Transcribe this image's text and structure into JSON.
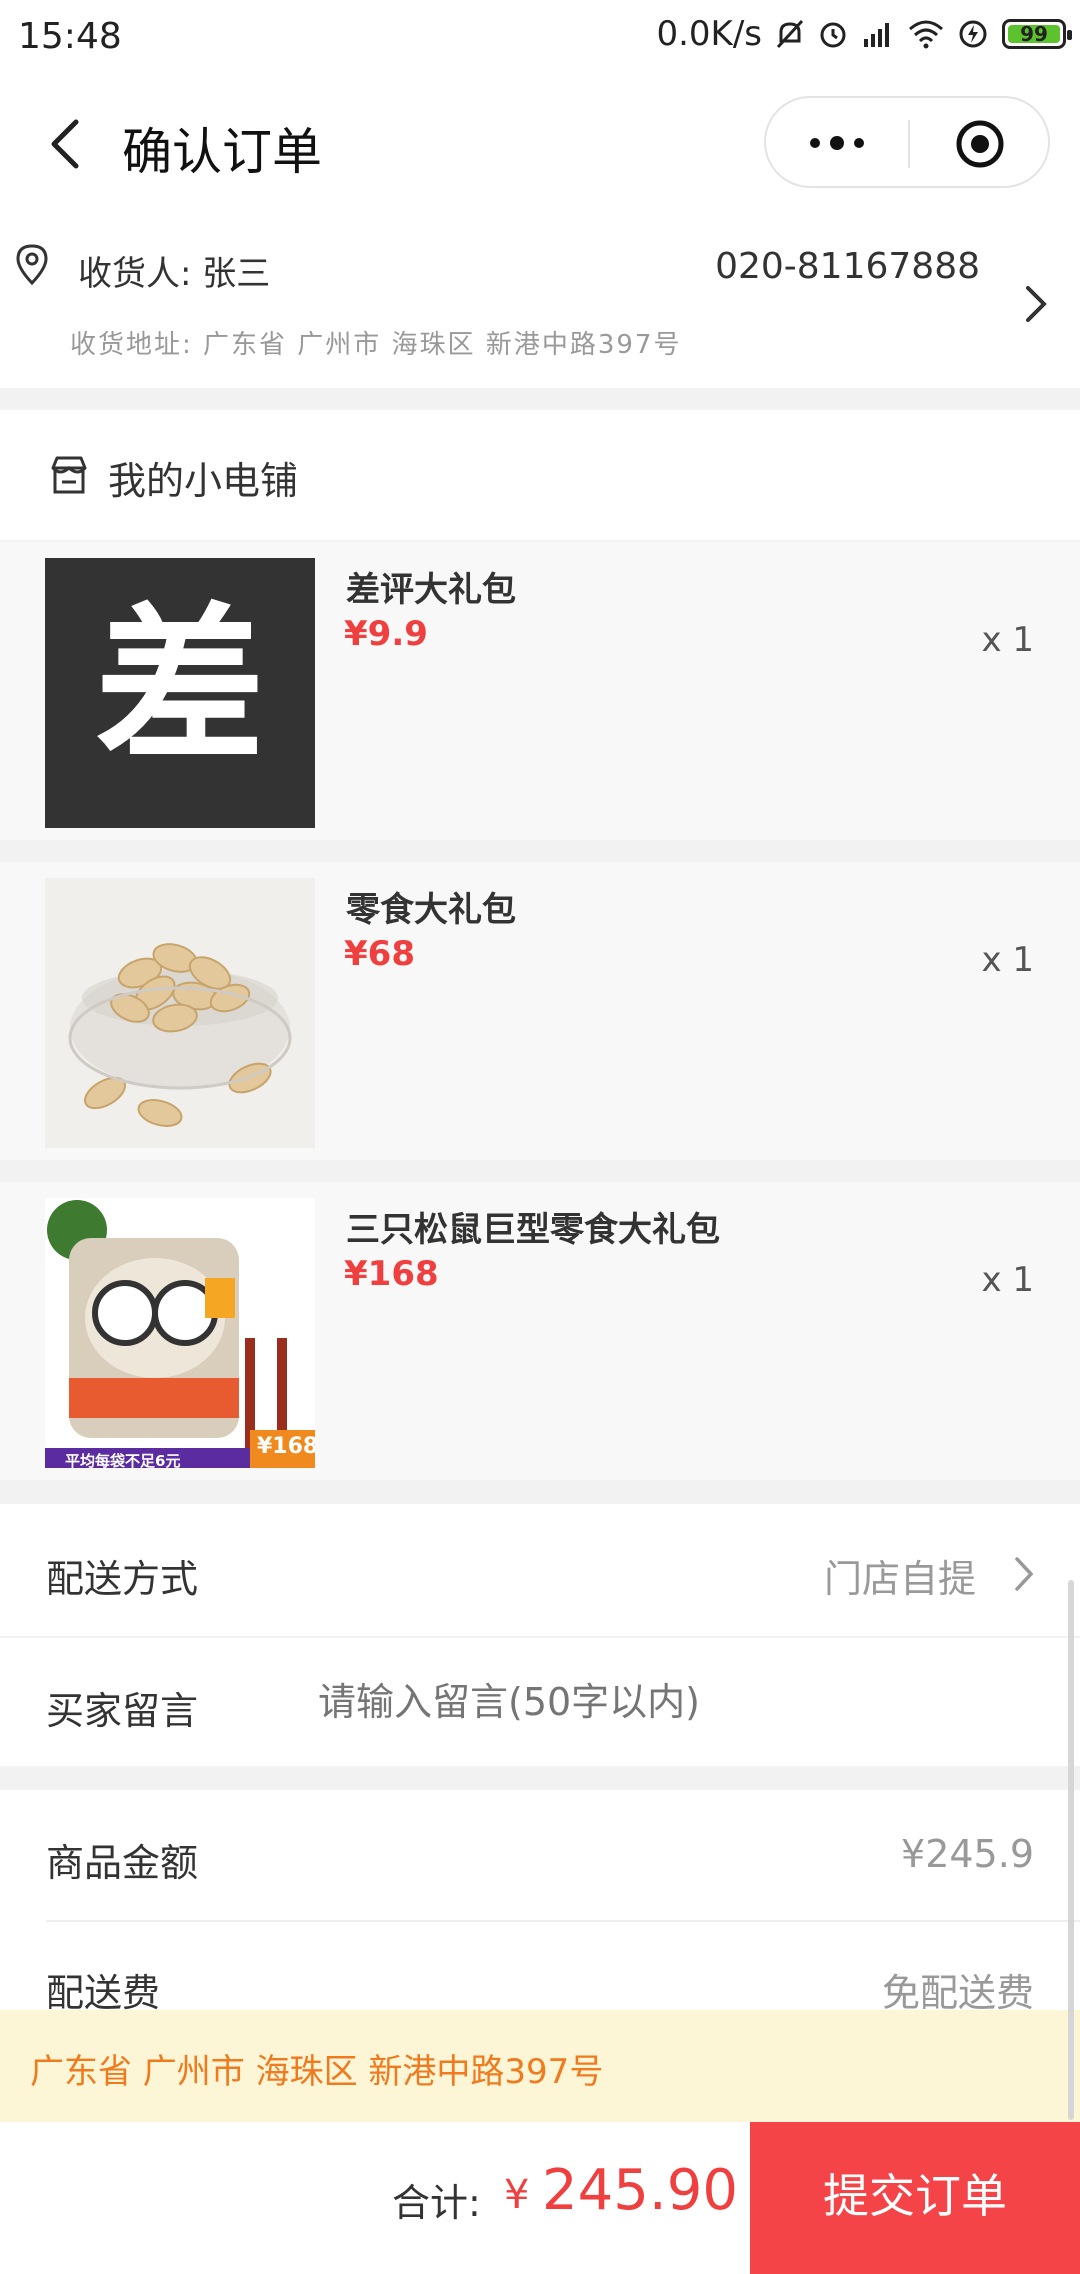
{
  "status_bar": {
    "time": "15:48",
    "net_speed": "0.0K/s",
    "battery": "99"
  },
  "nav": {
    "title": "确认订单"
  },
  "address": {
    "receiver_label": "收货人: 张三",
    "phone": "020-81167888",
    "detail": "收货地址: 广东省 广州市 海珠区 新港中路397号"
  },
  "shop": {
    "name": "我的小电铺"
  },
  "products": [
    {
      "name": "差评大礼包",
      "price": "¥9.9",
      "qty": "x 1",
      "thumb_text": "差"
    },
    {
      "name": "零食大礼包",
      "price": "¥68",
      "qty": "x 1"
    },
    {
      "name": "三只松鼠巨型零食大礼包",
      "price": "¥168",
      "qty": "x 1",
      "badge_price": "¥168",
      "badge_text": "平均每袋不足6元"
    }
  ],
  "delivery": {
    "label": "配送方式",
    "value": "门店自提"
  },
  "message": {
    "label": "买家留言",
    "placeholder": "请输入留言(50字以内)"
  },
  "amounts": {
    "goods_label": "商品金额",
    "goods_value": "¥245.9",
    "shipping_label": "配送费",
    "shipping_value": "免配送费"
  },
  "notice": {
    "text": "广东省 广州市 海珠区 新港中路397号"
  },
  "footer": {
    "total_label": "合计:",
    "currency": "¥",
    "total_amount": "245.90",
    "submit_label": "提交订单"
  },
  "colors": {
    "accent_red": "#ef3f3f",
    "submit_bg": "#f54448",
    "notice_bg": "#fdf6d6",
    "notice_text": "#f07a1e"
  }
}
